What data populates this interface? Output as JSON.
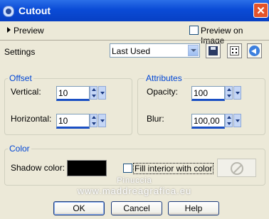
{
  "window": {
    "title": "Cutout",
    "close_icon": "close-icon"
  },
  "preview": {
    "label": "Preview",
    "preview_on_image_label": "Preview on Image",
    "preview_on_image_checked": false
  },
  "settings": {
    "label": "Settings",
    "preset_value": "Last Used",
    "buttons": [
      "save-icon",
      "randomize-icon",
      "reset-icon"
    ]
  },
  "offset": {
    "legend": "Offset",
    "vertical_label": "Vertical:",
    "vertical_value": "10",
    "horizontal_label": "Horizontal:",
    "horizontal_value": "10"
  },
  "attributes": {
    "legend": "Attributes",
    "opacity_label": "Opacity:",
    "opacity_value": "100",
    "blur_label": "Blur:",
    "blur_value": "100,00"
  },
  "color": {
    "legend": "Color",
    "shadow_label": "Shadow color:",
    "shadow_color": "#000000",
    "fill_label": "Fill interior with color",
    "fill_checked": false
  },
  "watermark": {
    "line1": "Pinuccia",
    "line2": "www.maddreagrafica.eu"
  },
  "footer": {
    "ok_label": "OK",
    "cancel_label": "Cancel",
    "help_label": "Help"
  }
}
